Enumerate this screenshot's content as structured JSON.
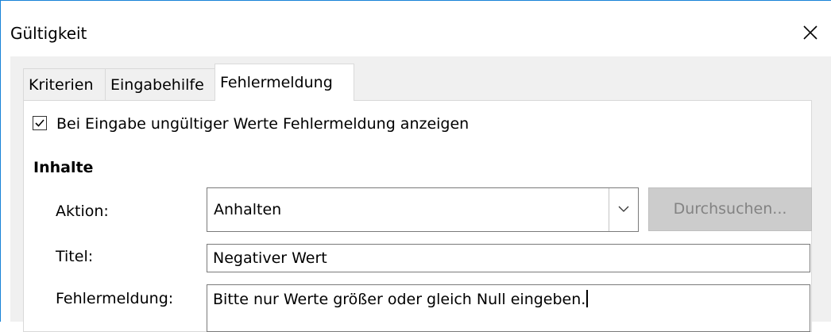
{
  "window": {
    "title": "Gültigkeit",
    "accent_color": "#1883d7"
  },
  "tabs": [
    {
      "label": "Kriterien",
      "active": false
    },
    {
      "label": "Eingabehilfe",
      "active": false
    },
    {
      "label": "Fehlermeldung",
      "active": true
    }
  ],
  "error_tab": {
    "show_error_checkbox": {
      "label": "Bei Eingabe ungültiger Werte Fehlermeldung anzeigen",
      "checked": true
    },
    "section_title": "Inhalte",
    "action": {
      "label": "Aktion:",
      "value": "Anhalten",
      "icon": "chevron-down-icon"
    },
    "browse_button": {
      "label": "Durchsuchen...",
      "enabled": false
    },
    "title_field": {
      "label": "Titel:",
      "value": "Negativer Wert"
    },
    "message_field": {
      "label": "Fehlermeldung:",
      "value": "Bitte nur Werte größer oder gleich Null eingeben."
    }
  }
}
